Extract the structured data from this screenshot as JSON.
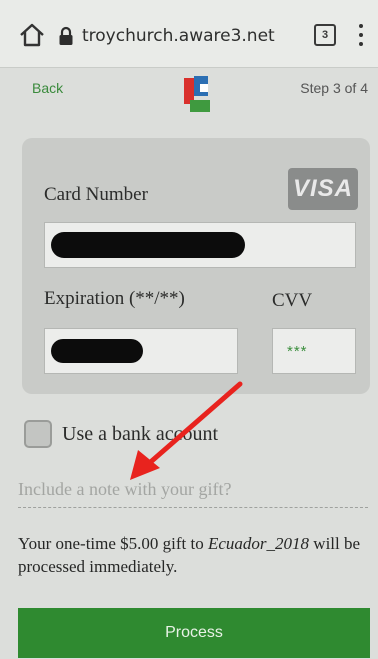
{
  "browser": {
    "url": "troychurch.aware3.net",
    "tab_count": "3",
    "icons": [
      "home-icon",
      "lock-icon",
      "tabs-icon",
      "more-vert-icon"
    ]
  },
  "header": {
    "back_label": "Back",
    "step_text": "Step 3 of 4",
    "logo_icon": "church-logo-icon",
    "logo_colors": {
      "red": "#d9302c",
      "blue": "#2c6fb3",
      "green": "#3f9a3f"
    }
  },
  "card_form": {
    "card_number_label": "Card Number",
    "card_brand": "VISA",
    "expiration_label": "Expiration (**/**)",
    "cvv_label": "CVV",
    "cvv_value": "***"
  },
  "bank_option": {
    "label": "Use a bank account",
    "checked": false
  },
  "note": {
    "placeholder": "Include a note with your gift?"
  },
  "summary": {
    "prefix": "Your one-time $5.00 gift to ",
    "fund": "Ecuador_2018",
    "suffix": " will be processed immediately."
  },
  "actions": {
    "process_label": "Process"
  },
  "colors": {
    "accent_green": "#2f8a30",
    "annotation_red": "#e8231e"
  }
}
